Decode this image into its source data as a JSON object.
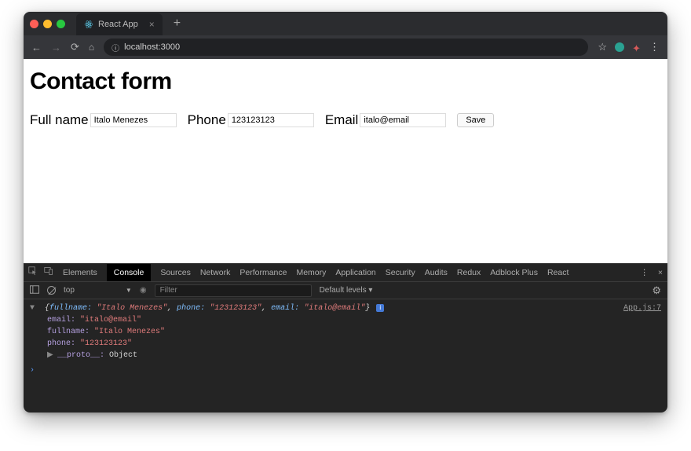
{
  "browser": {
    "tab_title": "React App",
    "url_text": "localhost:3000"
  },
  "page": {
    "heading": "Contact form",
    "labels": {
      "fullname": "Full name",
      "phone": "Phone",
      "email": "Email"
    },
    "values": {
      "fullname": "Italo Menezes",
      "phone": "123123123",
      "email": "italo@email"
    },
    "save_label": "Save"
  },
  "devtools": {
    "tabs": [
      "Elements",
      "Console",
      "Sources",
      "Network",
      "Performance",
      "Memory",
      "Application",
      "Security",
      "Audits",
      "Redux",
      "Adblock Plus",
      "React"
    ],
    "active_tab": "Console",
    "context": "top",
    "filter_placeholder": "Filter",
    "levels": "Default levels ▾",
    "log_source": "App.js:7",
    "log_summary_open": "{",
    "log_fullname_key": "fullname:",
    "log_fullname_val": "\"Italo Menezes\"",
    "log_phone_key": "phone:",
    "log_phone_val": "\"123123123\"",
    "log_email_key": "email:",
    "log_email_val": "\"italo@email\"",
    "log_summary_close": "}",
    "expanded": {
      "email_k": "email:",
      "email_v": "\"italo@email\"",
      "fullname_k": "fullname:",
      "fullname_v": "\"Italo Menezes\"",
      "phone_k": "phone:",
      "phone_v": "\"123123123\"",
      "proto_k": "__proto__:",
      "proto_v": "Object"
    }
  }
}
